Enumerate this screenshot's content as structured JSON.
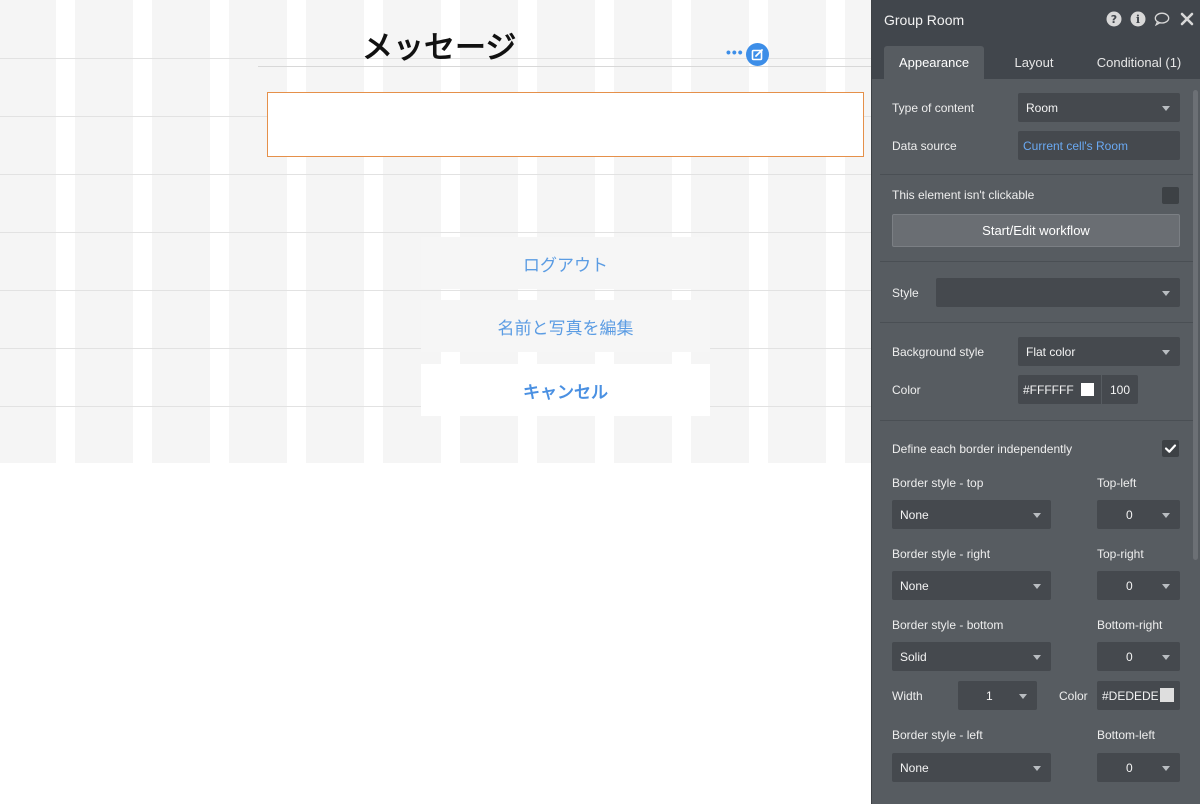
{
  "canvas": {
    "page_title": "メッセージ",
    "dots": "•••",
    "buttons": {
      "logout": "ログアウト",
      "edit_profile": "名前と写真を編集",
      "cancel": "キャンセル"
    }
  },
  "editor": {
    "title": "Group Room",
    "header_icons": [
      "help-icon",
      "info-icon",
      "comment-icon",
      "close-icon"
    ],
    "tabs": [
      {
        "label": "Appearance",
        "active": true
      },
      {
        "label": "Layout",
        "active": false
      },
      {
        "label": "Conditional (1)",
        "active": false
      }
    ],
    "type_of_content": {
      "label": "Type of content",
      "value": "Room"
    },
    "data_source": {
      "label": "Data source",
      "value": "Current cell's Room"
    },
    "not_clickable": {
      "label": "This element isn't clickable",
      "checked": false
    },
    "workflow_button": "Start/Edit workflow",
    "style": {
      "label": "Style",
      "value": ""
    },
    "background_style": {
      "label": "Background style",
      "value": "Flat color"
    },
    "color": {
      "label": "Color",
      "hex": "#FFFFFF",
      "opacity": "100",
      "swatch": "#ffffff"
    },
    "define_borders": {
      "label": "Define each border independently",
      "checked": true
    },
    "borders": {
      "top": {
        "label": "Border style - top",
        "value": "None",
        "radius_label": "Top-left",
        "radius": "0"
      },
      "right": {
        "label": "Border style - right",
        "value": "None",
        "radius_label": "Top-right",
        "radius": "0"
      },
      "bottom": {
        "label": "Border style - bottom",
        "value": "Solid",
        "radius_label": "Bottom-right",
        "radius": "0",
        "width_label": "Width",
        "width": "1",
        "color_label": "Color",
        "color_hex": "#DEDEDE",
        "color_swatch": "#dedede"
      },
      "left": {
        "label": "Border style - left",
        "value": "None",
        "radius_label": "Bottom-left",
        "radius": "0"
      }
    }
  },
  "colors": {
    "accent_blue": "#3d8ee8",
    "selection_orange": "#e5904a",
    "panel_bg": "#575c61",
    "panel_header": "#41464c",
    "link_blue": "#6aa9f2"
  }
}
